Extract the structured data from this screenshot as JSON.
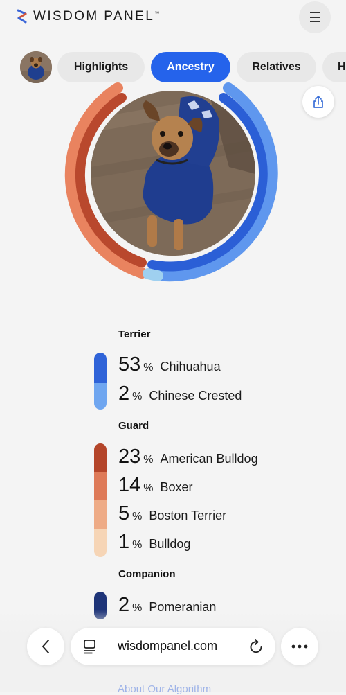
{
  "header": {
    "brand": "WISDOM PANEL",
    "trademark": "™"
  },
  "tabs": [
    {
      "label": "Highlights",
      "active": false
    },
    {
      "label": "Ancestry",
      "active": true
    },
    {
      "label": "Relatives",
      "active": false
    },
    {
      "label": "H",
      "active": false
    }
  ],
  "groups": [
    {
      "title": "Terrier",
      "breeds": [
        {
          "percent": "53",
          "sign": "%",
          "name": "Chihuahua",
          "color": "#2f63d8"
        },
        {
          "percent": "2",
          "sign": "%",
          "name": "Chinese Crested",
          "color": "#6fa6f0"
        }
      ]
    },
    {
      "title": "Guard",
      "breeds": [
        {
          "percent": "23",
          "sign": "%",
          "name": "American Bulldog",
          "color": "#b4452a"
        },
        {
          "percent": "14",
          "sign": "%",
          "name": "Boxer",
          "color": "#de7a58"
        },
        {
          "percent": "5",
          "sign": "%",
          "name": "Boston Terrier",
          "color": "#eeab86"
        },
        {
          "percent": "1",
          "sign": "%",
          "name": "Bulldog",
          "color": "#f6d5b6"
        }
      ]
    },
    {
      "title": "Companion",
      "breeds": [
        {
          "percent": "2",
          "sign": "%",
          "name": "Pomeranian",
          "color": "#1e3478"
        }
      ]
    }
  ],
  "browser": {
    "url": "wisdompanel.com",
    "peek_text": "About Our Algorithm"
  },
  "icons": {
    "menu": "hamburger-icon",
    "share": "share-icon",
    "back": "chevron-left-icon",
    "tabs": "tabs-icon",
    "reload": "reload-icon",
    "more": "more-icon"
  }
}
